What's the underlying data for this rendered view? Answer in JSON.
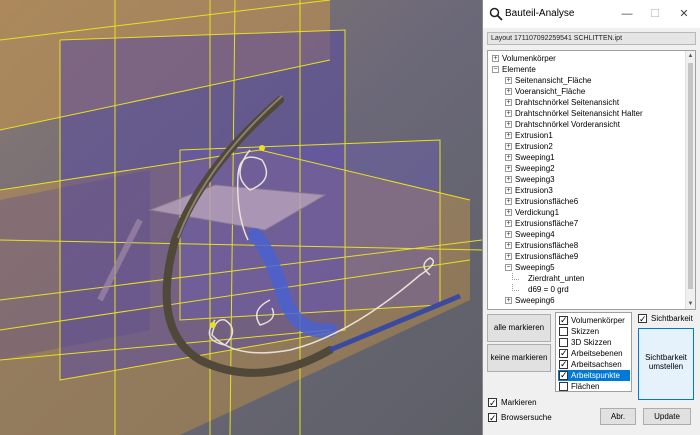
{
  "window": {
    "title": "Bauteil-Analyse",
    "minimize": "—",
    "maximize": "☐",
    "close": "✕",
    "layout_path": "Layout 171107092259541 SCHLITTEN.ipt"
  },
  "tree": {
    "items": [
      {
        "label": "Volumenkörper",
        "level": 0,
        "expander": "+"
      },
      {
        "label": "Elemente",
        "level": 0,
        "expander": "−"
      },
      {
        "label": "Seitenansicht_Fläche",
        "level": 1,
        "expander": "+"
      },
      {
        "label": "Voeransicht_Fläche",
        "level": 1,
        "expander": "+"
      },
      {
        "label": "Drahtschnörkel Seitenansicht",
        "level": 1,
        "expander": "+"
      },
      {
        "label": "Drahtschnörkel Seitenansicht Halter",
        "level": 1,
        "expander": "+"
      },
      {
        "label": "Drahtschnörkel Vorderansicht",
        "level": 1,
        "expander": "+"
      },
      {
        "label": "Extrusion1",
        "level": 1,
        "expander": "+"
      },
      {
        "label": "Extrusion2",
        "level": 1,
        "expander": "+"
      },
      {
        "label": "Sweeping1",
        "level": 1,
        "expander": "+"
      },
      {
        "label": "Sweeping2",
        "level": 1,
        "expander": "+"
      },
      {
        "label": "Sweeping3",
        "level": 1,
        "expander": "+"
      },
      {
        "label": "Extrusion3",
        "level": 1,
        "expander": "+"
      },
      {
        "label": "Extrusionsfläche6",
        "level": 1,
        "expander": "+"
      },
      {
        "label": "Verdickung1",
        "level": 1,
        "expander": "+"
      },
      {
        "label": "Extrusionsfläche7",
        "level": 1,
        "expander": "+"
      },
      {
        "label": "Sweeping4",
        "level": 1,
        "expander": "+"
      },
      {
        "label": "Extrusionsfläche8",
        "level": 1,
        "expander": "+"
      },
      {
        "label": "Extrusionsfläche9",
        "level": 1,
        "expander": "+"
      },
      {
        "label": "Sweeping5",
        "level": 1,
        "expander": "−"
      },
      {
        "label": "Zierdraht_unten",
        "level": 2,
        "expander": ""
      },
      {
        "label": "d69 = 0 grd",
        "level": 2,
        "expander": ""
      },
      {
        "label": "Sweeping6",
        "level": 1,
        "expander": "+"
      }
    ]
  },
  "buttons": {
    "mark_all": "alle markieren",
    "mark_none": "keine markieren",
    "visibility_line1": "Sichtbarkeit",
    "visibility_line2": "umstellen",
    "abort": "Abr.",
    "update": "Update"
  },
  "category_list": [
    {
      "label": "Volumenkörper",
      "checked": true,
      "selected": false
    },
    {
      "label": "Skizzen",
      "checked": false,
      "selected": false
    },
    {
      "label": "3D Skizzen",
      "checked": false,
      "selected": false
    },
    {
      "label": "Arbeitsebenen",
      "checked": true,
      "selected": false
    },
    {
      "label": "Arbeitsachsen",
      "checked": true,
      "selected": false
    },
    {
      "label": "Arbeitspunkte",
      "checked": true,
      "selected": true
    },
    {
      "label": "Flächen",
      "checked": false,
      "selected": false
    }
  ],
  "options": {
    "visibility_label": "Sichtbarkeit",
    "visibility_checked": true,
    "mark_label": "Markieren",
    "mark_checked": true,
    "browser_search_label": "Browsersuche",
    "browser_search_checked": true
  },
  "colors": {
    "selection": "#0078d7",
    "visibility_button_bg": "#e5f1fb",
    "visibility_button_border": "#0078d7",
    "work_plane_orange": "#c8964a",
    "work_plane_violet": "#6a5aa8",
    "work_plane_edge": "#e8e020"
  }
}
